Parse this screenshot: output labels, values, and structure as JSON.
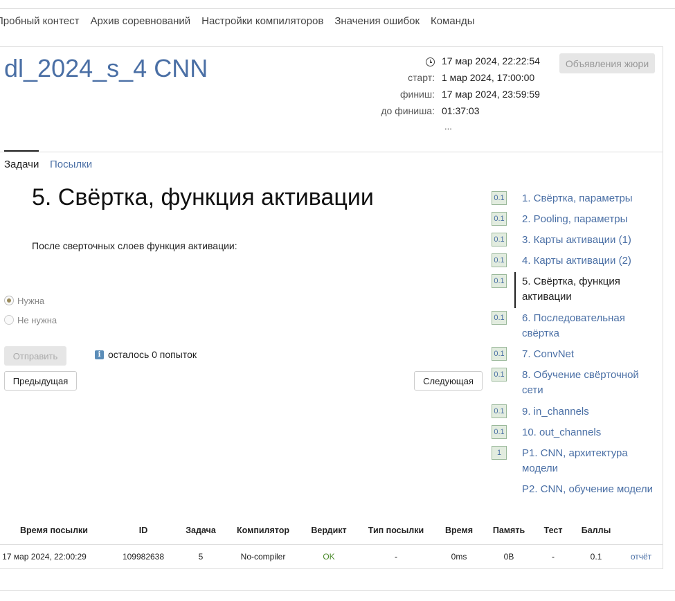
{
  "topnav": {
    "items": [
      "Пробный контест",
      "Архив соревнований",
      "Настройки компиляторов",
      "Значения ошибок",
      "Команды"
    ]
  },
  "contest": {
    "title": "dl_2024_s_4 CNN",
    "now": "17 мар 2024, 22:22:54",
    "start_label": "старт:",
    "start": "1 мар 2024, 17:00:00",
    "finish_label": "финиш:",
    "finish": "17 мар 2024, 23:59:59",
    "remaining_label": "до финиша:",
    "remaining": "01:37:03",
    "more": "...",
    "jury_button": "Объявления жюри"
  },
  "tabs": {
    "tasks": "Задачи",
    "submissions": "Посылки"
  },
  "problem": {
    "title": "5. Свёртка, функция активации",
    "statement": "После сверточных слоев функция активации:",
    "options": [
      {
        "label": "Нужна",
        "checked": true
      },
      {
        "label": "Не нужна",
        "checked": false
      }
    ],
    "submit_label": "Отправить",
    "attempts_text": "осталось 0 попыток",
    "info_glyph": "i",
    "prev_label": "Предыдущая",
    "next_label": "Следующая"
  },
  "problem_list": [
    {
      "badge": "0.1",
      "title": "1. Свёртка, параметры"
    },
    {
      "badge": "0.1",
      "title": "2. Pooling, параметры"
    },
    {
      "badge": "0.1",
      "title": "3. Карты активации (1)"
    },
    {
      "badge": "0.1",
      "title": "4. Карты активации (2)"
    },
    {
      "badge": "0.1",
      "title": "5. Свёртка, функция активации",
      "active": true
    },
    {
      "badge": "0.1",
      "title": "6. Последовательная свёртка"
    },
    {
      "badge": "0.1",
      "title": "7. ConvNet"
    },
    {
      "badge": "0.1",
      "title": "8. Обучение свёрточной сети"
    },
    {
      "badge": "0.1",
      "title": "9. in_channels"
    },
    {
      "badge": "0.1",
      "title": "10. out_channels"
    },
    {
      "badge": "1",
      "title": "P1. CNN, архитектура модели"
    },
    {
      "badge": "",
      "title": "P2. CNN, обучение модели"
    }
  ],
  "submissions": {
    "headers": [
      "Время посылки",
      "ID",
      "Задача",
      "Компилятор",
      "Вердикт",
      "Тип посылки",
      "Время",
      "Память",
      "Тест",
      "Баллы"
    ],
    "rows": [
      {
        "time": "17 мар 2024, 22:00:29",
        "id": "109982638",
        "task": "5",
        "compiler": "No-compiler",
        "verdict": "OK",
        "type": "-",
        "run_time": "0ms",
        "memory": "0B",
        "test": "-",
        "score": "0.1",
        "report": "отчёт"
      }
    ]
  },
  "colors": {
    "link": "#4a6fa5",
    "ok": "#4a8a2a",
    "badge_bg": "#e2ecdf"
  }
}
